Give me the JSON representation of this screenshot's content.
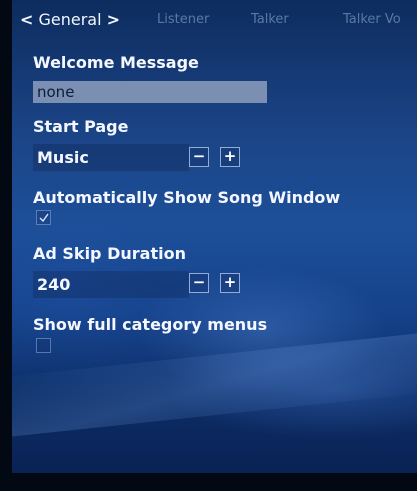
{
  "tabs": [
    {
      "label": "General",
      "active": true
    },
    {
      "label": "Listener",
      "active": false
    },
    {
      "label": "Talker",
      "active": false
    },
    {
      "label": "Talker Vo",
      "active": false
    }
  ],
  "nav": {
    "prev_glyph": "<",
    "next_glyph": ">"
  },
  "settings": {
    "welcome_message": {
      "label": "Welcome Message",
      "value": "none"
    },
    "start_page": {
      "label": "Start Page",
      "value": "Music",
      "decrement_glyph": "−",
      "increment_glyph": "+"
    },
    "auto_show_song_window": {
      "label": "Automatically Show Song Window",
      "checked": true
    },
    "ad_skip_duration": {
      "label": "Ad Skip Duration",
      "value": "240",
      "decrement_glyph": "−",
      "increment_glyph": "+"
    },
    "show_full_category_menus": {
      "label": "Show full category menus",
      "checked": false
    }
  },
  "colors": {
    "background_top": "#0d2c5e",
    "background_mid": "#1d4f99",
    "input_fill": "#7b8fb2",
    "inactive_tab": "#96b4dc"
  }
}
